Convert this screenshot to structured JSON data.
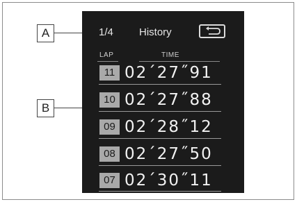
{
  "callouts": {
    "a": "A",
    "b": "B"
  },
  "header": {
    "page_indicator": "1/4",
    "title": "History",
    "back_icon": "return-arrow-icon"
  },
  "columns": {
    "lap": "LAP",
    "time": "TIME"
  },
  "laps": [
    {
      "lap": "11",
      "time": "02´27˝91"
    },
    {
      "lap": "10",
      "time": "02´27˝88"
    },
    {
      "lap": "09",
      "time": "02´28˝12"
    },
    {
      "lap": "08",
      "time": "02´27˝50"
    },
    {
      "lap": "07",
      "time": "02´30˝11"
    }
  ]
}
